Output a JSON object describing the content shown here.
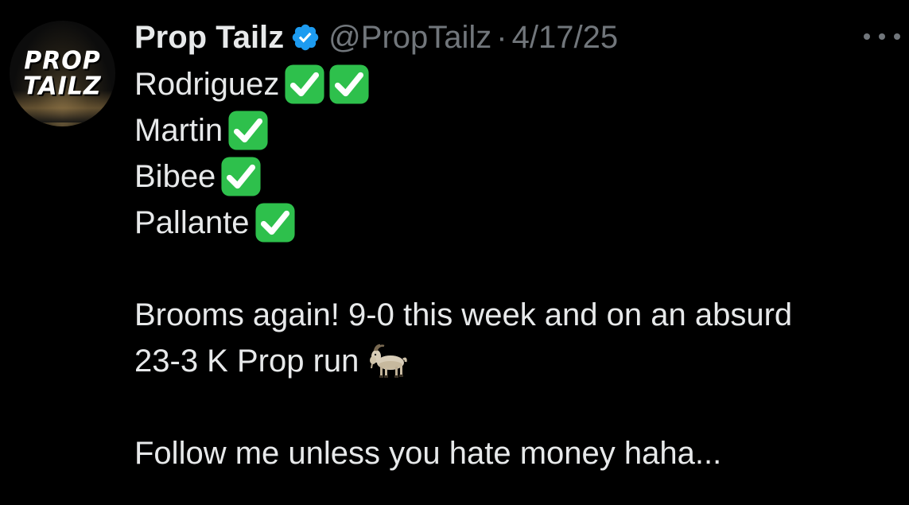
{
  "author": {
    "display_name": "Prop Tailz",
    "handle": "@PropTailz",
    "separator": "·",
    "date": "4/17/25",
    "avatar_text_line1": "PROP",
    "avatar_text_line2": "TAILZ",
    "verified": true,
    "verified_color": "#1d9bf0"
  },
  "tweet": {
    "lines": [
      {
        "text": "Rodriguez",
        "checks": 2
      },
      {
        "text": "Martin",
        "checks": 1
      },
      {
        "text": "Bibee",
        "checks": 1
      },
      {
        "text": "Pallante",
        "checks": 1
      }
    ],
    "paragraph1_line1": "Brooms again! 9-0 this week and on an absurd",
    "paragraph1_line2": "23-3 K Prop run",
    "paragraph1_emoji": "goat-icon",
    "paragraph2": "Follow me unless you hate money haha..."
  },
  "icons": {
    "check": "check-mark-button-icon",
    "more": "more-options-icon",
    "verified": "verified-badge-icon"
  },
  "colors": {
    "background": "#000000",
    "primary_text": "#e7e9ea",
    "secondary_text": "#71767b",
    "check_green": "#2ec04c"
  }
}
